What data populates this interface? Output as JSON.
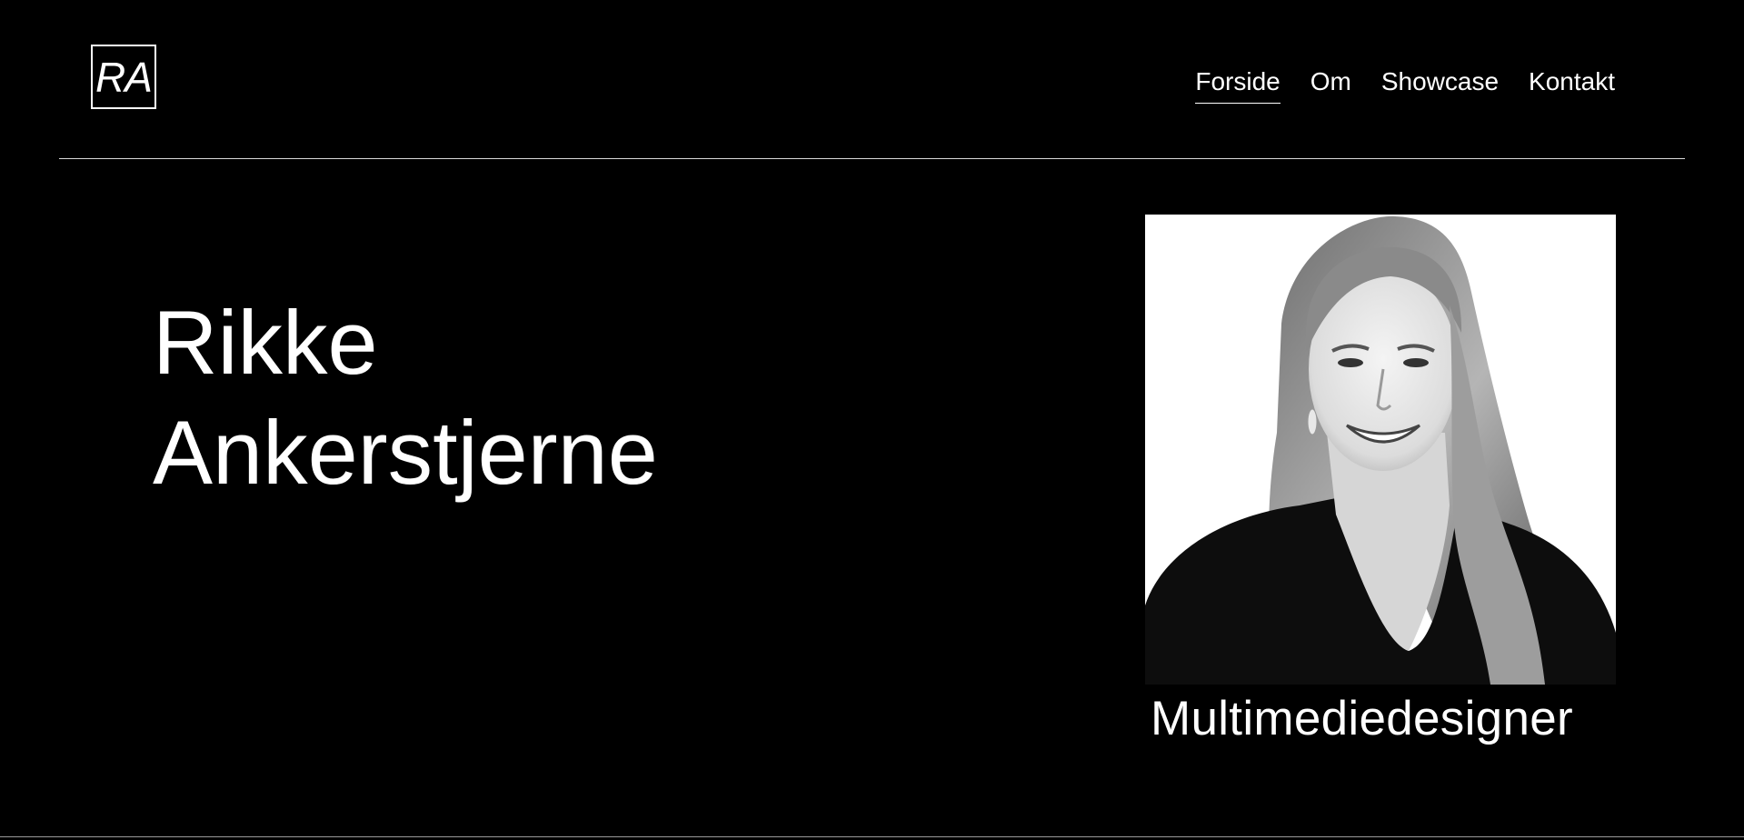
{
  "header": {
    "logo_text": "RA",
    "nav": [
      {
        "label": "Forside",
        "active": true
      },
      {
        "label": "Om",
        "active": false
      },
      {
        "label": "Showcase",
        "active": false
      },
      {
        "label": "Kontakt",
        "active": false
      }
    ]
  },
  "hero": {
    "first_name": "Rikke",
    "last_name": "Ankerstjerne",
    "title": "Multimediedesigner"
  },
  "colors": {
    "background": "#000000",
    "text": "#ffffff",
    "divider": "#d9d9d9"
  }
}
